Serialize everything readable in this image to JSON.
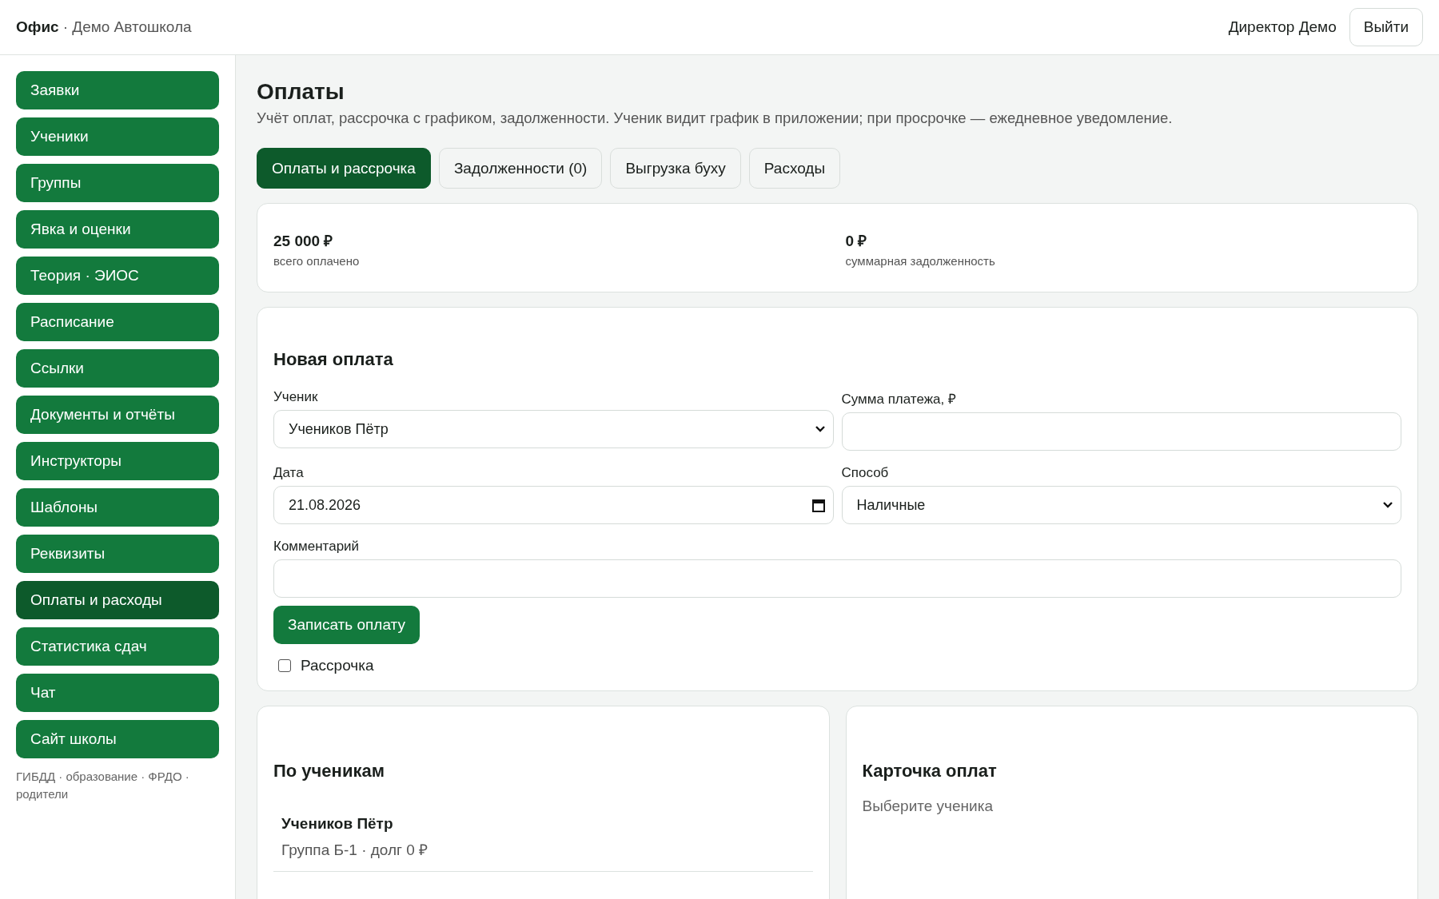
{
  "header": {
    "brand": "Офис",
    "org": "· Демо Автошкола",
    "user": "Директор Демо",
    "logout": "Выйти"
  },
  "sidebar": {
    "items": [
      {
        "label": "Заявки",
        "selected": false
      },
      {
        "label": "Ученики",
        "selected": false
      },
      {
        "label": "Группы",
        "selected": false
      },
      {
        "label": "Явка и оценки",
        "selected": false
      },
      {
        "label": "Теория · ЭИОС",
        "selected": false
      },
      {
        "label": "Расписание",
        "selected": false
      },
      {
        "label": "Ссылки",
        "selected": false
      },
      {
        "label": "Документы и отчёты",
        "selected": false
      },
      {
        "label": "Инструкторы",
        "selected": false
      },
      {
        "label": "Шаблоны",
        "selected": false
      },
      {
        "label": "Реквизиты",
        "selected": false
      },
      {
        "label": "Оплаты и расходы",
        "selected": true
      },
      {
        "label": "Статистика сдач",
        "selected": false
      },
      {
        "label": "Чат",
        "selected": false
      },
      {
        "label": "Сайт школы",
        "selected": false
      }
    ],
    "footer": "ГИБДД · образование · ФРДО · родители"
  },
  "page": {
    "title": "Оплаты",
    "description": "Учёт оплат, рассрочка с графиком, задолженности. Ученик видит график в приложении; при просрочке — ежедневное уведомление."
  },
  "tabs": [
    {
      "label": "Оплаты и рассрочка",
      "selected": true
    },
    {
      "label": "Задолженности (0)",
      "selected": false
    },
    {
      "label": "Выгрузка буху",
      "selected": false
    },
    {
      "label": "Расходы",
      "selected": false
    }
  ],
  "summary": [
    {
      "value": "25 000 ₽",
      "caption": "всего оплачено"
    },
    {
      "value": "0 ₽",
      "caption": "суммарная задолженность"
    }
  ],
  "new_payment": {
    "title": "Новая оплата",
    "fields": [
      {
        "kind": "select",
        "label": "Ученик",
        "value": "Учеников Пётр"
      },
      {
        "kind": "text",
        "label": "Сумма платежа, ₽"
      },
      {
        "kind": "date",
        "label": "Дата",
        "value": "21.08.2026"
      },
      {
        "kind": "select",
        "label": "Способ",
        "value": "Наличные"
      },
      {
        "kind": "wide",
        "label": "Комментарий"
      }
    ],
    "submit": "Записать оплату",
    "installment": {
      "label": "Рассрочка",
      "checked": false
    }
  },
  "by_students": {
    "title": "По ученикам",
    "rows": [
      {
        "name": "Учеников Пётр",
        "detail": "Группа Б-1 · долг 0 ₽"
      }
    ]
  },
  "payment_card": {
    "title": "Карточка оплат",
    "hint": "Выберите ученика"
  }
}
